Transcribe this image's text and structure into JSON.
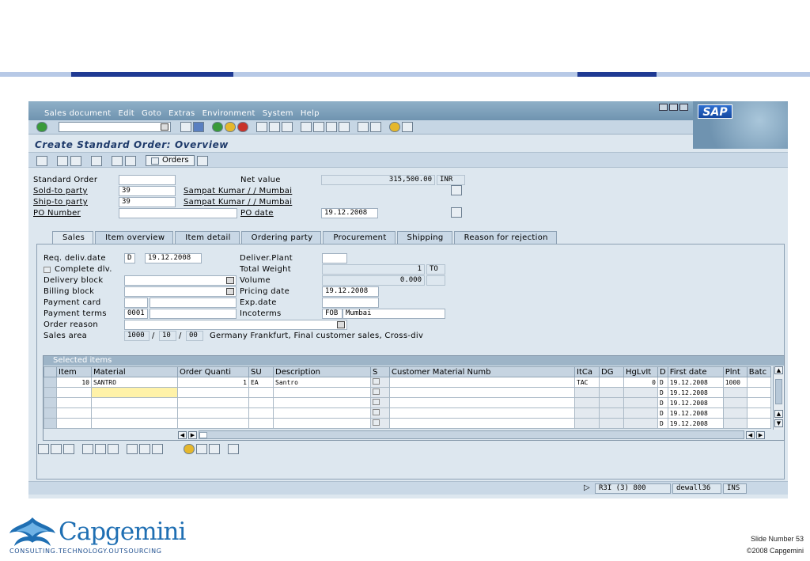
{
  "menu": [
    "Sales document",
    "Edit",
    "Goto",
    "Extras",
    "Environment",
    "System",
    "Help"
  ],
  "sap_logo": "SAP",
  "screen_title": "Create Standard Order: Overview",
  "toolbar2": {
    "orders_label": "Orders"
  },
  "header": {
    "standard_order_label": "Standard Order",
    "net_value_label": "Net value",
    "net_value": "315,500.00",
    "currency": "INR",
    "sold_to_label": "Sold-to party",
    "sold_to_value": "39",
    "sold_to_name": "Sampat Kumar / / Mumbai",
    "ship_to_label": "Ship-to party",
    "ship_to_value": "39",
    "ship_to_name": "Sampat Kumar / / Mumbai",
    "po_number_label": "PO Number",
    "po_date_label": "PO date",
    "po_date": "19.12.2008"
  },
  "tabs": [
    "Sales",
    "Item overview",
    "Item detail",
    "Ordering party",
    "Procurement",
    "Shipping",
    "Reason for rejection"
  ],
  "sales_tab": {
    "req_deliv_label": "Req. deliv.date",
    "req_deliv_type": "D",
    "req_deliv_date": "19.12.2008",
    "deliver_plant_label": "Deliver.Plant",
    "complete_dlv_label": "Complete dlv.",
    "total_weight_label": "Total Weight",
    "total_weight": "1",
    "weight_unit": "TO",
    "delivery_block_label": "Delivery block",
    "volume_label": "Volume",
    "volume": "0.000",
    "billing_block_label": "Billing block",
    "pricing_date_label": "Pricing date",
    "pricing_date": "19.12.2008",
    "payment_card_label": "Payment card",
    "exp_date_label": "Exp.date",
    "payment_terms_label": "Payment terms",
    "payment_terms": "0001",
    "incoterms_label": "Incoterms",
    "incoterms_code": "FOB",
    "incoterms_place": "Mumbai",
    "order_reason_label": "Order reason",
    "sales_area_label": "Sales area",
    "sales_org": "1000",
    "distr_channel": "10",
    "division": "00",
    "sales_area_desc": "Germany Frankfurt, Final customer sales, Cross-div"
  },
  "items": {
    "title": "Selected items",
    "columns": [
      "Item",
      "Material",
      "Order Quanti",
      "SU",
      "Description",
      "S",
      "Customer Material Numb",
      "ItCa",
      "DG",
      "HgLvIt",
      "D",
      "First date",
      "Plnt",
      "Batc"
    ],
    "rows": [
      [
        "10",
        "SANTRO",
        "1",
        "EA",
        "Santro",
        "",
        "",
        "TAC",
        "",
        "0",
        "D",
        "19.12.2008",
        "1000",
        ""
      ],
      [
        "",
        "",
        "",
        "",
        "",
        "",
        "",
        "",
        "",
        "",
        "D",
        "19.12.2008",
        "",
        ""
      ],
      [
        "",
        "",
        "",
        "",
        "",
        "",
        "",
        "",
        "",
        "",
        "D",
        "19.12.2008",
        "",
        ""
      ],
      [
        "",
        "",
        "",
        "",
        "",
        "",
        "",
        "",
        "",
        "",
        "D",
        "19.12.2008",
        "",
        ""
      ],
      [
        "",
        "",
        "",
        "",
        "",
        "",
        "",
        "",
        "",
        "",
        "D",
        "19.12.2008",
        "",
        ""
      ]
    ]
  },
  "status": {
    "system": "R3I (3) 800",
    "user": "dewall36",
    "mode": "INS"
  },
  "footer": {
    "company": "Capgemini",
    "tagline": "CONSULTING.TECHNOLOGY.OUTSOURCING",
    "slide_number": "Slide Number 53",
    "copyright": "©2008 Capgemini"
  },
  "colors": {
    "brand_blue": "#1f6fb3",
    "band_dark": "#1f3a93",
    "band_light": "#b7c9e6"
  }
}
